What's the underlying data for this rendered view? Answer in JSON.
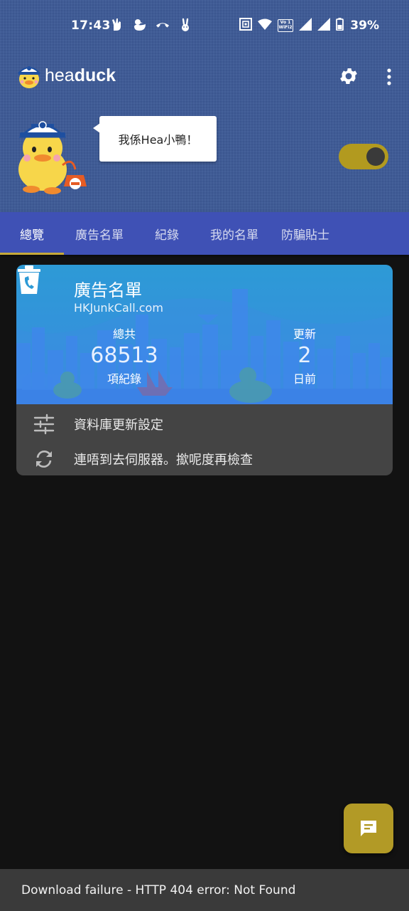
{
  "status_bar": {
    "time": "17:43",
    "battery_percent": "39%",
    "notification_icons": [
      "peace-hand-icon",
      "duck-icon",
      "phone-hangup-icon",
      "rabbit-icon"
    ],
    "system_icons": [
      "nfc-icon",
      "wifi-icon",
      "vowifi-icon",
      "signal-icon",
      "signal-icon",
      "battery-icon"
    ],
    "vowifi_label_top": "Vo 1",
    "vowifi_label_bottom": "WiFi2"
  },
  "app_bar": {
    "title_light": "hea",
    "title_bold": "duck"
  },
  "hero": {
    "speech_bubble": "我係Hea小鴨！",
    "toggle_on": true
  },
  "tabs": [
    {
      "label": "總覽",
      "active": true
    },
    {
      "label": "廣告名單",
      "active": false
    },
    {
      "label": "紀錄",
      "active": false
    },
    {
      "label": "我的名單",
      "active": false
    },
    {
      "label": "防騙貼士",
      "active": false
    }
  ],
  "card": {
    "title": "廣告名單",
    "subtitle": "HKJunkCall.com",
    "total_label": "總共",
    "total_value": "68513",
    "total_unit": "項紀錄",
    "update_label": "更新",
    "update_value": "2",
    "update_unit": "日前",
    "rows": [
      {
        "icon": "sliders-icon",
        "label": "資料庫更新設定"
      },
      {
        "icon": "sync-icon",
        "label": "連唔到去伺服器。撳呢度再檢查"
      }
    ]
  },
  "snackbar": {
    "message": "Download failure - HTTP 404 error: Not Found"
  },
  "colors": {
    "header_bg": "#3d5a96",
    "tab_bar": "#3f51b5",
    "tab_indicator": "#c6a93a",
    "accent_gold": "#b29a26",
    "card_banner": "#2d9ad6",
    "background": "#121212"
  }
}
